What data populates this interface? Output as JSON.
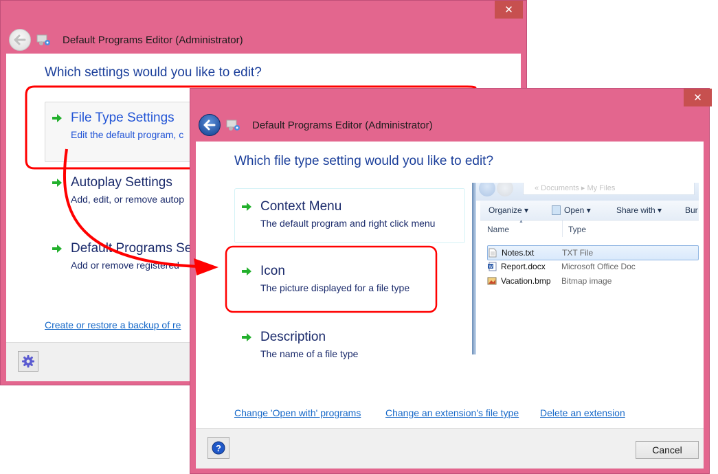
{
  "back_window": {
    "title": "Default Programs Editor (Administrator)",
    "close_label": "✕",
    "heading": "Which settings would you like to edit?",
    "options": [
      {
        "title": "File Type Settings",
        "description": "Edit the default program, c"
      },
      {
        "title": "Autoplay Settings",
        "description": "Add, edit, or remove autop"
      },
      {
        "title": "Default Programs Se",
        "description": "Add or remove registered"
      }
    ],
    "backup_link": "Create or restore a backup of re",
    "settings_icon": "gear-icon"
  },
  "front_window": {
    "title": "Default Programs Editor (Administrator)",
    "close_label": "✕",
    "heading": "Which file type setting would you like to edit?",
    "options": [
      {
        "title": "Context Menu",
        "description": "The default program and right click menu"
      },
      {
        "title": "Icon",
        "description": "The picture displayed for a file type"
      },
      {
        "title": "Description",
        "description": "The name of a file type"
      }
    ],
    "links": [
      "Change 'Open with' programs",
      "Change an extension's file type",
      "Delete an extension"
    ],
    "cancel_label": "Cancel",
    "help_icon": "help-icon"
  },
  "explorer_preview": {
    "breadcrumb": "« Documents ▸ My Files",
    "toolbar": [
      "Organize ▾",
      "Open ▾",
      "Share with ▾",
      "Bur"
    ],
    "columns": [
      "Name",
      "Type"
    ],
    "files": [
      {
        "name": "Notes.txt",
        "type": "TXT File",
        "icon": "text-file-icon",
        "selected": true
      },
      {
        "name": "Report.docx",
        "type": "Microsoft Office Doc",
        "icon": "word-doc-icon",
        "selected": false
      },
      {
        "name": "Vacation.bmp",
        "type": "Bitmap image",
        "icon": "bitmap-image-icon",
        "selected": false
      }
    ]
  },
  "colors": {
    "window_frame": "#e3668e",
    "close_button": "#c7504f",
    "heading_text": "#1a3e9a",
    "link_text": "#1668c8",
    "annotation_red": "#ff0000",
    "arrow_green": "#22b02c"
  }
}
